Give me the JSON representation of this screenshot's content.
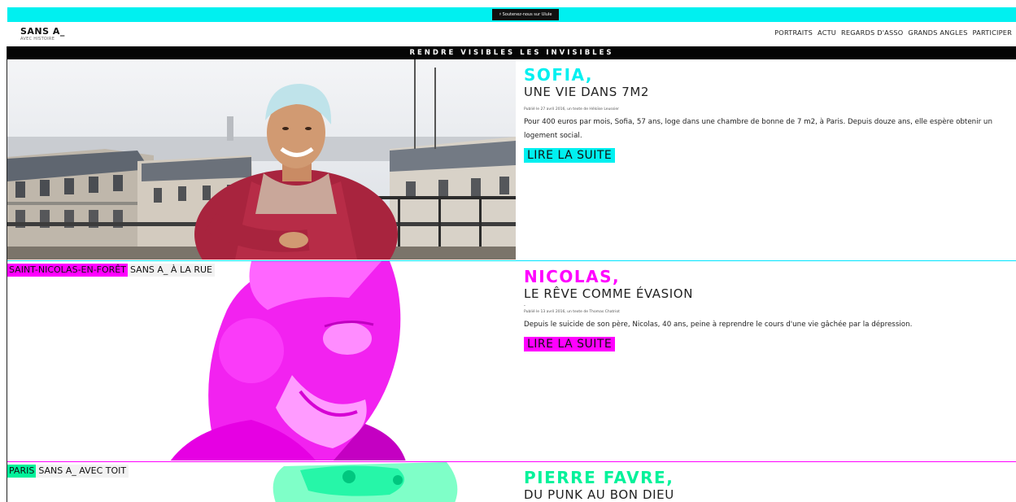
{
  "topbar": {
    "button_label": "♯ Soutenez-nous sur Ulule"
  },
  "header": {
    "logo_main": "SANS A_",
    "logo_sub": "AVEC HISTOIRE",
    "nav": [
      "PORTRAITS",
      "ACTU",
      "REGARDS D'ASSO",
      "GRANDS ANGLES",
      "PARTICIPER"
    ]
  },
  "tagline": "RENDRE VISIBLES LES INVISIBLES",
  "colors": {
    "cyan": "#00f0f0",
    "magenta": "#ff00ff",
    "green": "#00f29a"
  },
  "stories": [
    {
      "name": "SOFIA,",
      "subtitle": "UNE VIE DANS 7M2",
      "byline": "Publié le 27 avril 2016, un texte de Héloïse Leussier",
      "excerpt": "Pour 400 euros par mois, Sofia, 57 ans, loge dans une chambre de bonne de 7 m2, à Paris. Depuis douze ans, elle espère obtenir un logement social.",
      "read_more": "LIRE LA SUITE",
      "accent": "#00f0f0"
    },
    {
      "name": "NICOLAS,",
      "subtitle": "LE RÊVE COMME ÉVASION",
      "dash": "-",
      "byline": "Publié le 13 avril 2016, un texte de Thomas Chatriot",
      "excerpt": "Depuis le suicide de son père, Nicolas, 40 ans, peine à reprendre le cours d'une vie gâchée par la dépression.",
      "read_more": "LIRE LA SUITE",
      "place_tag": "SAINT-NICOLAS-EN-FORÊT",
      "category_tag": "SANS A_ À LA RUE",
      "accent": "#ff00ff"
    },
    {
      "name": "PIERRE FAVRE,",
      "subtitle": "DU PUNK AU BON DIEU",
      "place_tag": "PARIS",
      "category_tag": "SANS A_ AVEC TOIT",
      "accent": "#00f29a"
    }
  ]
}
